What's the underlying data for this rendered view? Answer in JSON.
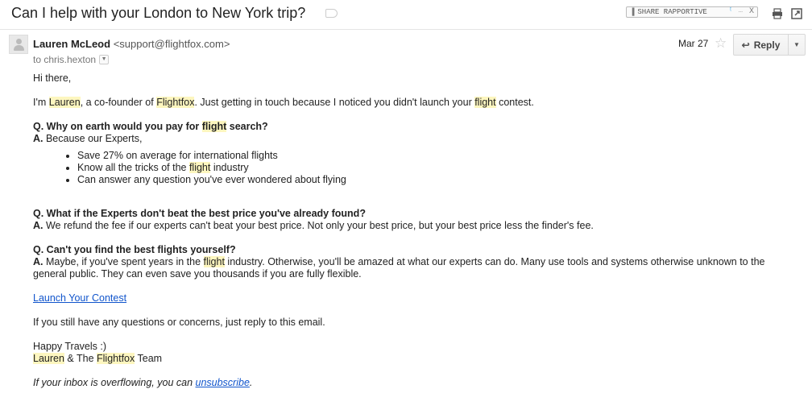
{
  "subject": "Can I help with your London to New York trip?",
  "rapportive": {
    "label": "SHARE RAPPORTIVE",
    "close": "X"
  },
  "toolbar": {
    "print_icon": "print-icon",
    "popout_icon": "popout-icon"
  },
  "message": {
    "sender_name": "Lauren McLeod",
    "sender_email": "<support@flightfox.com>",
    "to": "to chris.hexton",
    "date": "Mar 27",
    "reply_label": "Reply",
    "greeting": "Hi there,",
    "intro": {
      "p1": "I'm ",
      "name": "Lauren",
      "p2": ", a co-founder of ",
      "company": "Flightfox",
      "p3": ". Just getting in touch because I noticed you didn't launch your ",
      "hl": "flight",
      "p4": " contest."
    },
    "q1": {
      "q_prefix": "Q. Why on earth would you pay for ",
      "q_hl": "flight",
      "q_suffix": " search?",
      "a_prefix": "A.",
      "a_text": " Because our Experts,"
    },
    "bullets": {
      "b1": "Save 27% on average for international flights",
      "b2_pre": "Know all the tricks of the ",
      "b2_hl": "flight",
      "b2_post": " industry",
      "b3": "Can answer any question you've ever wondered about flying"
    },
    "q2": {
      "q": "Q. What if the Experts don't beat the best price you've already found?",
      "a_prefix": "A.",
      "a_text": " We refund the fee if our experts can't beat your best price. Not only your best price, but your best price less the finder's fee."
    },
    "q3": {
      "q": "Q. Can't you find the best flights yourself?",
      "a_prefix": "A.",
      "a_text1": " Maybe, if you've spent years in the ",
      "a_hl": "flight",
      "a_text2": " industry. Otherwise, you'll be amazed at what our experts can do. Many use tools and systems otherwise unknown to the general public. They can even save you thousands if you are fully flexible."
    },
    "cta_link": "Launch Your Contest",
    "followup": "If you still have any questions or concerns, just reply to this email.",
    "signoff": "Happy Travels :)",
    "sig": {
      "name": "Lauren",
      "mid": " & The ",
      "company": "Flightfox",
      "end": " Team"
    },
    "footer": {
      "pre": "If your inbox is overflowing, you can ",
      "link": "unsubscribe",
      "post": "."
    }
  },
  "colors": {
    "highlight": "#fdf6bf",
    "link": "#1155cc"
  }
}
